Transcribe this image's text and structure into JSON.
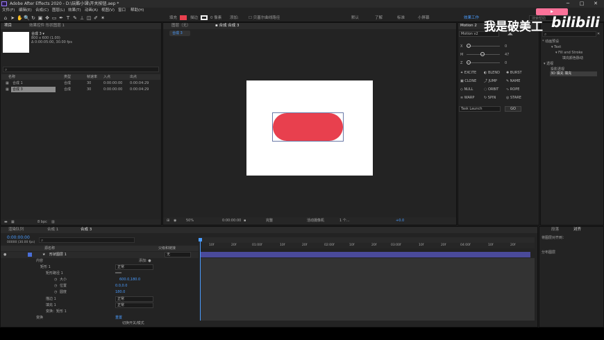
{
  "window": {
    "title": "Adobe After Effects 2020 - D:\\玩酷小课\\开关按钮.aep *",
    "minimize": "─",
    "maximize": "□",
    "close": "✕"
  },
  "menu": [
    "文件(F)",
    "编辑(E)",
    "合成(C)",
    "图层(L)",
    "效果(T)",
    "动画(A)",
    "视图(V)",
    "窗口",
    "帮助(H)"
  ],
  "toolbar": {
    "fill_label": "填充",
    "stroke_label": "描边",
    "stroke_width": "0 像素",
    "add_label": "添加:",
    "bezier_label": "贝塞尔曲线路径",
    "workspaces": [
      "默认",
      "了解",
      "标准",
      "小屏幕",
      "效果工作"
    ],
    "search_help": "搜索帮助"
  },
  "project": {
    "tab_project": "项目",
    "tab_effects": "效果控件 形状图层 1",
    "comp_name": "合成 3 ▾",
    "comp_size": "800 x 600 (1.00)",
    "comp_duration": "Δ 0:00:05:00, 30.00 fps",
    "columns": [
      "名称",
      "类型",
      "帧速率",
      "入点",
      "出点"
    ],
    "items": [
      {
        "name": "合成 1",
        "type": "合成",
        "fps": "30",
        "in": "0:00:00:00",
        "out": "0:00:04:29"
      },
      {
        "name": "合成 3",
        "type": "合成",
        "fps": "30",
        "in": "0:00:00:00",
        "out": "0:00:04:29"
      }
    ],
    "bpc": "8 bpc"
  },
  "viewer": {
    "tab_layer": "图层（无）",
    "tab_comp": "合成 合成 3",
    "breadcrumb": "合成 3",
    "zoom": "50%",
    "timecode": "0:00:00:00",
    "quality": "完整",
    "camera": "活动摄像机",
    "views": "1 个...",
    "offset": "+0.0",
    "pill_color": "#e8404e"
  },
  "motion": {
    "title": "Motion 2",
    "version": "Motion v2",
    "val1": "0",
    "val2": "47",
    "val3": "0",
    "buttons": [
      "EXCITE",
      "BLEND",
      "BURST",
      "CLONE",
      "JUMP",
      "NAME",
      "NULL",
      "ORBIT",
      "ROPE",
      "WARP",
      "SPIN",
      "STARE"
    ],
    "task": "Task Launch",
    "go": "GO"
  },
  "effects_panel": {
    "title": "效果和预设",
    "tree": [
      "* 动画预设",
      "Text",
      "Fill and Stroke",
      "填充颜色脉动",
      "透视",
      "投影透视",
      "3D 填充",
      "填充"
    ]
  },
  "timeline": {
    "tabs": [
      "渲染队列",
      "合成 1",
      "合成 3"
    ],
    "timecode": "0:00:00:00",
    "fps_note": "00000 (30.00 fps)",
    "col_source": "源名称",
    "col_mode": "父级和链接",
    "layer_name": "形状图层 1",
    "parent": "无",
    "props": [
      {
        "label": "内容",
        "value": "添加: ●"
      },
      {
        "label": "矩形 1",
        "value": "正常"
      },
      {
        "label": "矩形路径 1",
        "value": "═══"
      },
      {
        "label": "大小",
        "value": "600.0,180.0"
      },
      {
        "label": "位置",
        "value": "0.0,0.0"
      },
      {
        "label": "圆度",
        "value": "180.0"
      },
      {
        "label": "描边 1",
        "value": "正常"
      },
      {
        "label": "填充 1",
        "value": "正常"
      },
      {
        "label": "变换：矩形 1",
        "value": ""
      },
      {
        "label": "变换",
        "value": "重置"
      }
    ],
    "ruler": [
      "0f",
      "10f",
      "20f",
      "01:00f",
      "10f",
      "20f",
      "02:00f",
      "10f",
      "20f",
      "03:00f",
      "10f",
      "20f",
      "04:00f",
      "10f",
      "20f"
    ],
    "footer_toggle": "切换开关/模式"
  },
  "right_panel": {
    "tabs": [
      "段落",
      "对齐"
    ],
    "label_align": "将图层对齐到：",
    "dist": "分布图层"
  },
  "watermark": {
    "text": "我是破美工",
    "brand": "bilibili"
  }
}
